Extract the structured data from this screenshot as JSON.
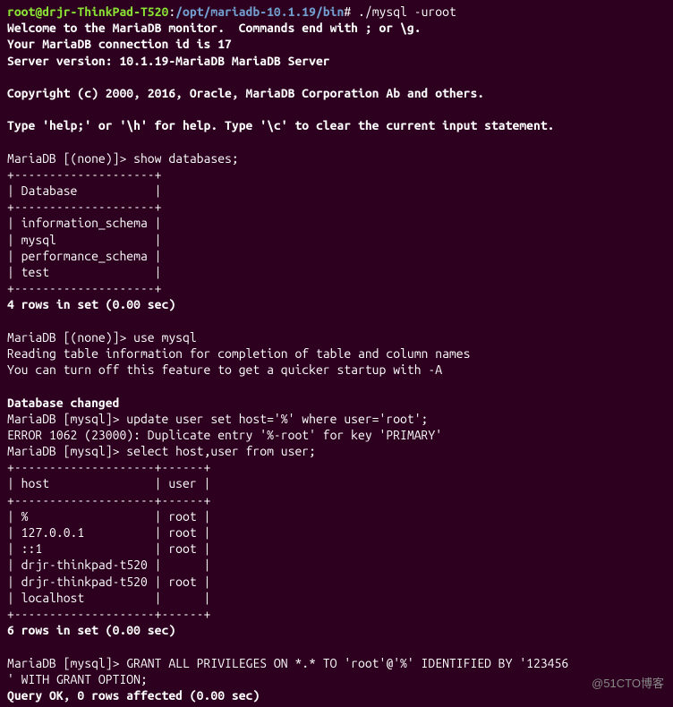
{
  "prompt": {
    "user_host": "root@drjr-ThinkPad-T520",
    "colon": ":",
    "path": "/opt/mariadb-10.1.19/bin",
    "hash": "#",
    "command": " ./mysql -uroot"
  },
  "welcome": {
    "line1": "Welcome to the MariaDB monitor.  Commands end with ; or \\g.",
    "line2": "Your MariaDB connection id is 17",
    "line3": "Server version: 10.1.19-MariaDB MariaDB Server",
    "copyright": "Copyright (c) 2000, 2016, Oracle, MariaDB Corporation Ab and others.",
    "help": "Type 'help;' or '\\h' for help. Type '\\c' to clear the current input statement."
  },
  "db1": {
    "prompt": "MariaDB [(none)]> ",
    "cmd": "show databases;",
    "sep": "+--------------------+",
    "header": "| Database           |",
    "rows": [
      "| information_schema |",
      "| mysql              |",
      "| performance_schema |",
      "| test               |"
    ],
    "result": "4 rows in set (0.00 sec)"
  },
  "use": {
    "prompt": "MariaDB [(none)]> ",
    "cmd": "use mysql",
    "reading": "Reading table information for completion of table and column names",
    "turnoff": "You can turn off this feature to get a quicker startup with -A",
    "changed": "Database changed"
  },
  "update": {
    "prompt": "MariaDB [mysql]> ",
    "cmd": "update user set host='%' where user='root';",
    "error": "ERROR 1062 (23000): Duplicate entry '%-root' for key 'PRIMARY'"
  },
  "select": {
    "prompt": "MariaDB [mysql]> ",
    "cmd": "select host,user from user;",
    "sep": "+--------------------+------+",
    "header": "| host               | user |",
    "rows": [
      "| %                  | root |",
      "| 127.0.0.1          | root |",
      "| ::1                | root |",
      "| drjr-thinkpad-t520 |      |",
      "| drjr-thinkpad-t520 | root |",
      "| localhost          |      |"
    ],
    "result": "6 rows in set (0.00 sec)"
  },
  "grant": {
    "prompt": "MariaDB [mysql]> ",
    "cmd1": "GRANT ALL PRIVILEGES ON *.* TO 'root'@'%' IDENTIFIED BY '123456",
    "cmd2": "' WITH GRANT OPTION;",
    "result": "Query OK, 0 rows affected (0.00 sec)"
  },
  "watermark": "@51CTO博客"
}
